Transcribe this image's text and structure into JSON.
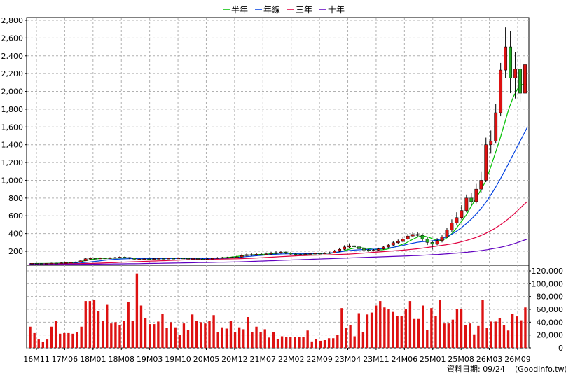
{
  "chart_data": [
    {
      "type": "candlestick",
      "title": "",
      "y_ticks": [
        "2,800",
        "2,600",
        "2,400",
        "2,200",
        "2,000",
        "1,800",
        "1,600",
        "1,400",
        "1,200",
        "1,000",
        "800",
        "600",
        "400",
        "200"
      ],
      "ylim": [
        0,
        2900
      ],
      "grid": true,
      "legend_position": "top-center",
      "legend": [
        {
          "name": "半年",
          "color": "#00c000"
        },
        {
          "name": "年線",
          "color": "#0040e0"
        },
        {
          "name": "三年",
          "color": "#e00040"
        },
        {
          "name": "十年",
          "color": "#6000c0"
        }
      ],
      "up_color": "#dd1111",
      "down_color": "#22aa22",
      "candles": [
        {
          "o": 60,
          "c": 64,
          "h": 68,
          "l": 57
        },
        {
          "o": 64,
          "c": 62,
          "h": 67,
          "l": 58
        },
        {
          "o": 62,
          "c": 60,
          "h": 65,
          "l": 56
        },
        {
          "o": 60,
          "c": 63,
          "h": 66,
          "l": 57
        },
        {
          "o": 63,
          "c": 66,
          "h": 70,
          "l": 60
        },
        {
          "o": 66,
          "c": 65,
          "h": 70,
          "l": 61
        },
        {
          "o": 65,
          "c": 70,
          "h": 74,
          "l": 62
        },
        {
          "o": 70,
          "c": 72,
          "h": 78,
          "l": 66
        },
        {
          "o": 72,
          "c": 76,
          "h": 82,
          "l": 69
        },
        {
          "o": 76,
          "c": 80,
          "h": 86,
          "l": 72
        },
        {
          "o": 80,
          "c": 92,
          "h": 98,
          "l": 76
        },
        {
          "o": 92,
          "c": 115,
          "h": 125,
          "l": 88
        },
        {
          "o": 115,
          "c": 120,
          "h": 132,
          "l": 108
        },
        {
          "o": 120,
          "c": 118,
          "h": 128,
          "l": 110
        },
        {
          "o": 118,
          "c": 122,
          "h": 130,
          "l": 112
        },
        {
          "o": 122,
          "c": 120,
          "h": 128,
          "l": 114
        },
        {
          "o": 120,
          "c": 124,
          "h": 132,
          "l": 115
        },
        {
          "o": 124,
          "c": 128,
          "h": 136,
          "l": 118
        },
        {
          "o": 128,
          "c": 134,
          "h": 142,
          "l": 122
        },
        {
          "o": 134,
          "c": 130,
          "h": 140,
          "l": 124
        },
        {
          "o": 130,
          "c": 122,
          "h": 134,
          "l": 112
        },
        {
          "o": 122,
          "c": 110,
          "h": 126,
          "l": 104
        },
        {
          "o": 110,
          "c": 112,
          "h": 118,
          "l": 102
        },
        {
          "o": 112,
          "c": 114,
          "h": 120,
          "l": 106
        },
        {
          "o": 114,
          "c": 112,
          "h": 120,
          "l": 106
        },
        {
          "o": 112,
          "c": 116,
          "h": 122,
          "l": 108
        },
        {
          "o": 116,
          "c": 118,
          "h": 124,
          "l": 110
        },
        {
          "o": 118,
          "c": 116,
          "h": 122,
          "l": 110
        },
        {
          "o": 116,
          "c": 120,
          "h": 126,
          "l": 112
        },
        {
          "o": 120,
          "c": 118,
          "h": 126,
          "l": 112
        },
        {
          "o": 118,
          "c": 122,
          "h": 128,
          "l": 114
        },
        {
          "o": 122,
          "c": 120,
          "h": 128,
          "l": 114
        },
        {
          "o": 120,
          "c": 116,
          "h": 126,
          "l": 108
        },
        {
          "o": 116,
          "c": 118,
          "h": 124,
          "l": 108
        },
        {
          "o": 118,
          "c": 112,
          "h": 124,
          "l": 100
        },
        {
          "o": 112,
          "c": 110,
          "h": 118,
          "l": 102
        },
        {
          "o": 110,
          "c": 114,
          "h": 120,
          "l": 104
        },
        {
          "o": 114,
          "c": 120,
          "h": 126,
          "l": 110
        },
        {
          "o": 120,
          "c": 126,
          "h": 134,
          "l": 116
        },
        {
          "o": 126,
          "c": 128,
          "h": 136,
          "l": 120
        },
        {
          "o": 128,
          "c": 130,
          "h": 138,
          "l": 122
        },
        {
          "o": 130,
          "c": 132,
          "h": 140,
          "l": 124
        },
        {
          "o": 132,
          "c": 136,
          "h": 160,
          "l": 126
        },
        {
          "o": 136,
          "c": 150,
          "h": 172,
          "l": 130
        },
        {
          "o": 150,
          "c": 162,
          "h": 180,
          "l": 140
        },
        {
          "o": 162,
          "c": 158,
          "h": 178,
          "l": 148
        },
        {
          "o": 158,
          "c": 166,
          "h": 182,
          "l": 150
        },
        {
          "o": 166,
          "c": 162,
          "h": 180,
          "l": 152
        },
        {
          "o": 162,
          "c": 170,
          "h": 186,
          "l": 154
        },
        {
          "o": 170,
          "c": 176,
          "h": 192,
          "l": 160
        },
        {
          "o": 176,
          "c": 184,
          "h": 198,
          "l": 166
        },
        {
          "o": 184,
          "c": 190,
          "h": 206,
          "l": 172
        },
        {
          "o": 190,
          "c": 180,
          "h": 198,
          "l": 168
        },
        {
          "o": 180,
          "c": 168,
          "h": 190,
          "l": 156
        },
        {
          "o": 168,
          "c": 160,
          "h": 176,
          "l": 150
        },
        {
          "o": 160,
          "c": 164,
          "h": 172,
          "l": 152
        },
        {
          "o": 164,
          "c": 170,
          "h": 178,
          "l": 156
        },
        {
          "o": 170,
          "c": 172,
          "h": 180,
          "l": 162
        },
        {
          "o": 172,
          "c": 176,
          "h": 184,
          "l": 164
        },
        {
          "o": 176,
          "c": 174,
          "h": 184,
          "l": 166
        },
        {
          "o": 174,
          "c": 178,
          "h": 188,
          "l": 168
        },
        {
          "o": 178,
          "c": 182,
          "h": 194,
          "l": 170
        },
        {
          "o": 182,
          "c": 200,
          "h": 216,
          "l": 176
        },
        {
          "o": 200,
          "c": 222,
          "h": 240,
          "l": 192
        },
        {
          "o": 222,
          "c": 248,
          "h": 268,
          "l": 214
        },
        {
          "o": 248,
          "c": 262,
          "h": 290,
          "l": 236
        },
        {
          "o": 262,
          "c": 250,
          "h": 272,
          "l": 236
        },
        {
          "o": 250,
          "c": 228,
          "h": 262,
          "l": 214
        },
        {
          "o": 228,
          "c": 214,
          "h": 236,
          "l": 200
        },
        {
          "o": 214,
          "c": 206,
          "h": 222,
          "l": 196
        },
        {
          "o": 206,
          "c": 212,
          "h": 224,
          "l": 198
        },
        {
          "o": 212,
          "c": 226,
          "h": 240,
          "l": 204
        },
        {
          "o": 226,
          "c": 248,
          "h": 262,
          "l": 218
        },
        {
          "o": 248,
          "c": 270,
          "h": 286,
          "l": 240
        },
        {
          "o": 270,
          "c": 296,
          "h": 314,
          "l": 262
        },
        {
          "o": 296,
          "c": 310,
          "h": 332,
          "l": 286
        },
        {
          "o": 310,
          "c": 340,
          "h": 362,
          "l": 300
        },
        {
          "o": 340,
          "c": 372,
          "h": 396,
          "l": 330
        },
        {
          "o": 372,
          "c": 390,
          "h": 412,
          "l": 360
        },
        {
          "o": 390,
          "c": 380,
          "h": 420,
          "l": 362
        },
        {
          "o": 380,
          "c": 340,
          "h": 394,
          "l": 318
        },
        {
          "o": 340,
          "c": 300,
          "h": 356,
          "l": 270
        },
        {
          "o": 300,
          "c": 280,
          "h": 320,
          "l": 220
        },
        {
          "o": 280,
          "c": 320,
          "h": 348,
          "l": 268
        },
        {
          "o": 320,
          "c": 360,
          "h": 380,
          "l": 300
        },
        {
          "o": 360,
          "c": 440,
          "h": 460,
          "l": 350
        },
        {
          "o": 440,
          "c": 520,
          "h": 560,
          "l": 420
        },
        {
          "o": 520,
          "c": 580,
          "h": 640,
          "l": 500
        },
        {
          "o": 580,
          "c": 660,
          "h": 720,
          "l": 560
        },
        {
          "o": 660,
          "c": 800,
          "h": 840,
          "l": 640
        },
        {
          "o": 800,
          "c": 760,
          "h": 860,
          "l": 720
        },
        {
          "o": 760,
          "c": 900,
          "h": 960,
          "l": 740
        },
        {
          "o": 900,
          "c": 1000,
          "h": 1100,
          "l": 860
        },
        {
          "o": 1000,
          "c": 1400,
          "h": 1480,
          "l": 980
        },
        {
          "o": 1400,
          "c": 1440,
          "h": 1560,
          "l": 1300
        },
        {
          "o": 1440,
          "c": 1760,
          "h": 1860,
          "l": 1420
        },
        {
          "o": 1760,
          "c": 2240,
          "h": 2320,
          "l": 1720
        },
        {
          "o": 2240,
          "c": 2500,
          "h": 2720,
          "l": 2150
        },
        {
          "o": 2500,
          "c": 2150,
          "h": 2680,
          "l": 1980
        },
        {
          "o": 2150,
          "c": 2250,
          "h": 2440,
          "l": 1920
        },
        {
          "o": 2250,
          "c": 1980,
          "h": 2360,
          "l": 1880
        },
        {
          "o": 1980,
          "c": 2300,
          "h": 2520,
          "l": 1940
        }
      ],
      "ma": {
        "半年": [
          60,
          61,
          62,
          62,
          63,
          64,
          65,
          66,
          68,
          70,
          75,
          85,
          95,
          105,
          112,
          118,
          121,
          122,
          123,
          124,
          125,
          124,
          121,
          118,
          116,
          115,
          115,
          116,
          117,
          118,
          118,
          119,
          120,
          119,
          118,
          116,
          114,
          114,
          116,
          119,
          123,
          126,
          129,
          134,
          140,
          148,
          154,
          158,
          162,
          164,
          166,
          170,
          174,
          179,
          183,
          182,
          178,
          172,
          169,
          168,
          170,
          172,
          174,
          176,
          178,
          182,
          192,
          206,
          222,
          234,
          240,
          238,
          232,
          224,
          218,
          216,
          222,
          236,
          252,
          270,
          290,
          318,
          346,
          368,
          372,
          358,
          336,
          318,
          326,
          356,
          406,
          470,
          540,
          612,
          706,
          790,
          884,
          980,
          1120,
          1280,
          1440,
          1620,
          1800,
          1940,
          2040,
          2080,
          2080
        ],
        "年線": [
          58,
          58,
          59,
          59,
          60,
          60,
          61,
          62,
          62,
          63,
          65,
          68,
          72,
          78,
          84,
          90,
          96,
          102,
          107,
          110,
          113,
          115,
          117,
          117,
          117,
          117,
          117,
          117,
          117,
          117,
          118,
          118,
          118,
          118,
          118,
          118,
          117,
          117,
          117,
          117,
          118,
          119,
          121,
          123,
          126,
          130,
          134,
          139,
          144,
          149,
          153,
          157,
          161,
          165,
          168,
          170,
          171,
          171,
          171,
          171,
          172,
          173,
          175,
          176,
          178,
          180,
          185,
          191,
          198,
          205,
          211,
          215,
          218,
          220,
          222,
          224,
          227,
          232,
          238,
          246,
          255,
          266,
          278,
          290,
          300,
          307,
          311,
          315,
          322,
          334,
          352,
          376,
          406,
          440,
          480,
          524,
          572,
          626,
          686,
          754,
          830,
          914,
          1004,
          1100,
          1200,
          1300,
          1400,
          1500,
          1600
        ],
        "三年": [
          56,
          56,
          57,
          57,
          57,
          58,
          58,
          58,
          59,
          59,
          60,
          61,
          62,
          63,
          65,
          67,
          69,
          71,
          73,
          76,
          78,
          80,
          82,
          84,
          86,
          88,
          90,
          92,
          94,
          96,
          98,
          100,
          102,
          104,
          106,
          107,
          108,
          109,
          110,
          111,
          112,
          113,
          114,
          115,
          117,
          119,
          121,
          124,
          127,
          130,
          133,
          136,
          139,
          142,
          145,
          148,
          150,
          152,
          154,
          155,
          157,
          158,
          160,
          162,
          164,
          166,
          168,
          171,
          175,
          179,
          183,
          187,
          191,
          195,
          199,
          203,
          207,
          211,
          216,
          221,
          227,
          233,
          240,
          248,
          256,
          264,
          272,
          280,
          290,
          302,
          316,
          332,
          350,
          370,
          394,
          420,
          450,
          484,
          522,
          564,
          610,
          660,
          714,
          762
        ],
        "十年": [
          50,
          50,
          51,
          51,
          51,
          52,
          52,
          52,
          53,
          53,
          53,
          54,
          54,
          55,
          55,
          56,
          56,
          57,
          57,
          58,
          59,
          59,
          60,
          61,
          62,
          63,
          64,
          65,
          66,
          67,
          68,
          69,
          70,
          71,
          72,
          73,
          74,
          75,
          76,
          77,
          78,
          79,
          80,
          82,
          84,
          86,
          88,
          90,
          92,
          94,
          96,
          98,
          100,
          102,
          104,
          106,
          108,
          110,
          112,
          114,
          116,
          118,
          120,
          122,
          124,
          126,
          128,
          130,
          132,
          134,
          136,
          138,
          140,
          142,
          144,
          146,
          148,
          150,
          152,
          155,
          158,
          161,
          164,
          168,
          172,
          176,
          180,
          185,
          190,
          196,
          202,
          210,
          218,
          228,
          238,
          250,
          264,
          280,
          298,
          318,
          338
        ]
      }
    },
    {
      "type": "bar",
      "series_color": "#dd1111",
      "y_ticks": [
        "120,000",
        "100,000",
        "80,000",
        "60,000",
        "40,000",
        "20,000",
        "0"
      ],
      "ylim": [
        0,
        130000
      ],
      "grid": true,
      "values": [
        33000,
        23000,
        13000,
        9000,
        13000,
        33000,
        42000,
        22000,
        23000,
        23000,
        22000,
        25000,
        33000,
        73000,
        73000,
        75000,
        57000,
        42000,
        67000,
        38000,
        40000,
        36000,
        42000,
        72000,
        42000,
        116000,
        66000,
        46000,
        37000,
        37000,
        41000,
        53000,
        31000,
        40000,
        32000,
        20000,
        38000,
        28000,
        52000,
        42000,
        40000,
        38000,
        42000,
        51000,
        24000,
        32000,
        30000,
        42000,
        24000,
        32000,
        29000,
        48000,
        24000,
        33000,
        25000,
        29000,
        16000,
        24000,
        14000,
        18000,
        17000,
        17000,
        17000,
        17000,
        17000,
        27000,
        10000,
        14000,
        11000,
        12000,
        15000,
        15000,
        20000,
        62000,
        31000,
        35000,
        18000,
        54000,
        24000,
        52000,
        55000,
        66000,
        73000,
        63000,
        60000,
        56000,
        50000,
        50000,
        60000,
        73000,
        45000,
        45000,
        66000,
        28000,
        62000,
        50000,
        75000,
        38000,
        38000,
        44000,
        61000,
        60000,
        35000,
        38000,
        21000,
        34000,
        75000,
        31000,
        41000,
        41000,
        46000,
        35000,
        27000,
        53000,
        49000,
        43000,
        63000
      ],
      "x_ticks": [
        "16M11",
        "17M06",
        "18M01",
        "18M08",
        "19M03",
        "19M10",
        "20M05",
        "20M12",
        "21M07",
        "22M02",
        "22M09",
        "23M04",
        "23M11",
        "24M06",
        "25M01",
        "25M08",
        "26M03",
        "26M09"
      ]
    }
  ],
  "footer": {
    "date_label": "資料日期: 09/24",
    "source": "(Goodinfo.tw)"
  }
}
